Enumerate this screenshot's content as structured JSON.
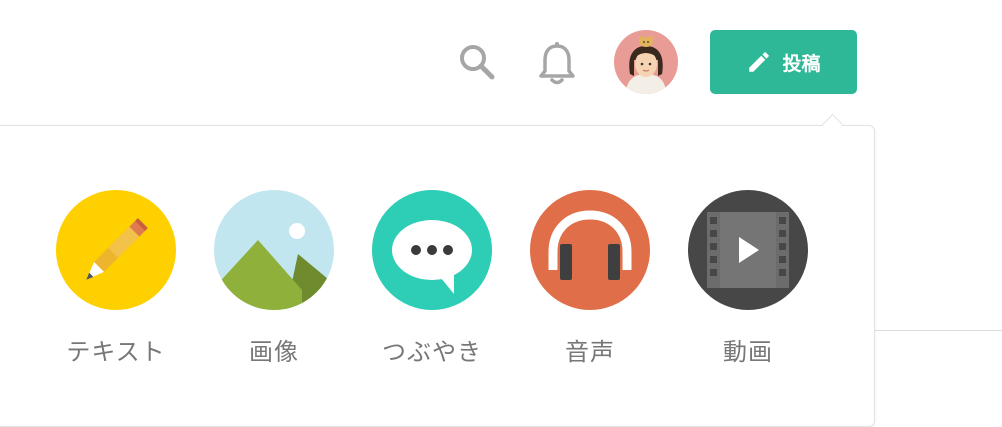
{
  "header": {
    "post_button_label": "投稿",
    "icons": [
      "search-icon",
      "bell-icon",
      "pencil-icon"
    ]
  },
  "post_types": [
    {
      "label": "テキスト",
      "icon": "pencil-icon",
      "color": "#ffd000"
    },
    {
      "label": "画像",
      "icon": "mountain-image-icon",
      "color": "#c2e6ef"
    },
    {
      "label": "つぶやき",
      "icon": "speech-bubble-icon",
      "color": "#2ecdb5"
    },
    {
      "label": "音声",
      "icon": "headphones-icon",
      "color": "#df6e49"
    },
    {
      "label": "動画",
      "icon": "film-play-icon",
      "color": "#474747"
    }
  ],
  "colors": {
    "accent": "#2fb897",
    "icon_gray": "#a6a6a6",
    "label_gray": "#777777"
  }
}
